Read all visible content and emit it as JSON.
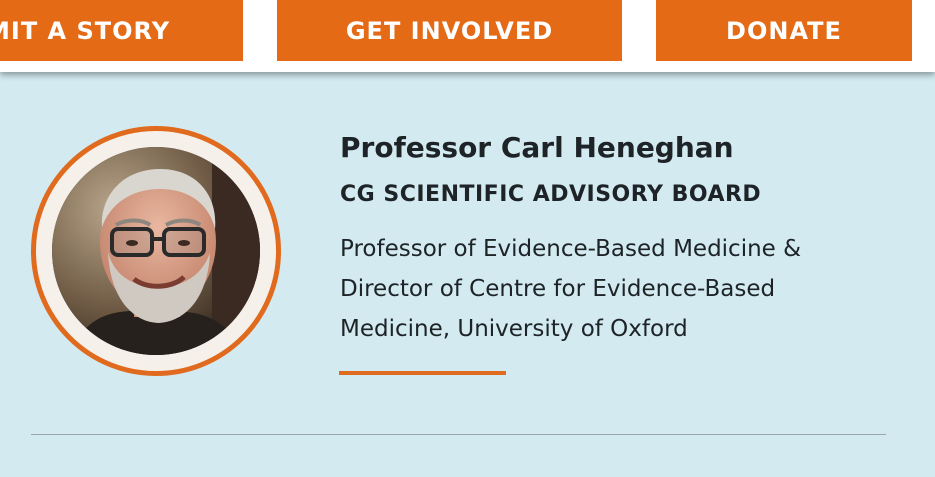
{
  "nav": {
    "submit_story": "MIT A STORY",
    "get_involved": "GET INVOLVED",
    "donate": "DONATE"
  },
  "profile": {
    "name": "Professor Carl Heneghan",
    "role": "CG SCIENTIFIC ADVISORY BOARD",
    "bio_lines": [
      "Professor of Evidence-Based Medicine &",
      "Director of Centre for Evidence-Based",
      "Medicine, University of Oxford"
    ]
  },
  "colors": {
    "accent": "#e46a16",
    "background": "#d2eaf0",
    "text": "#1d2326"
  }
}
